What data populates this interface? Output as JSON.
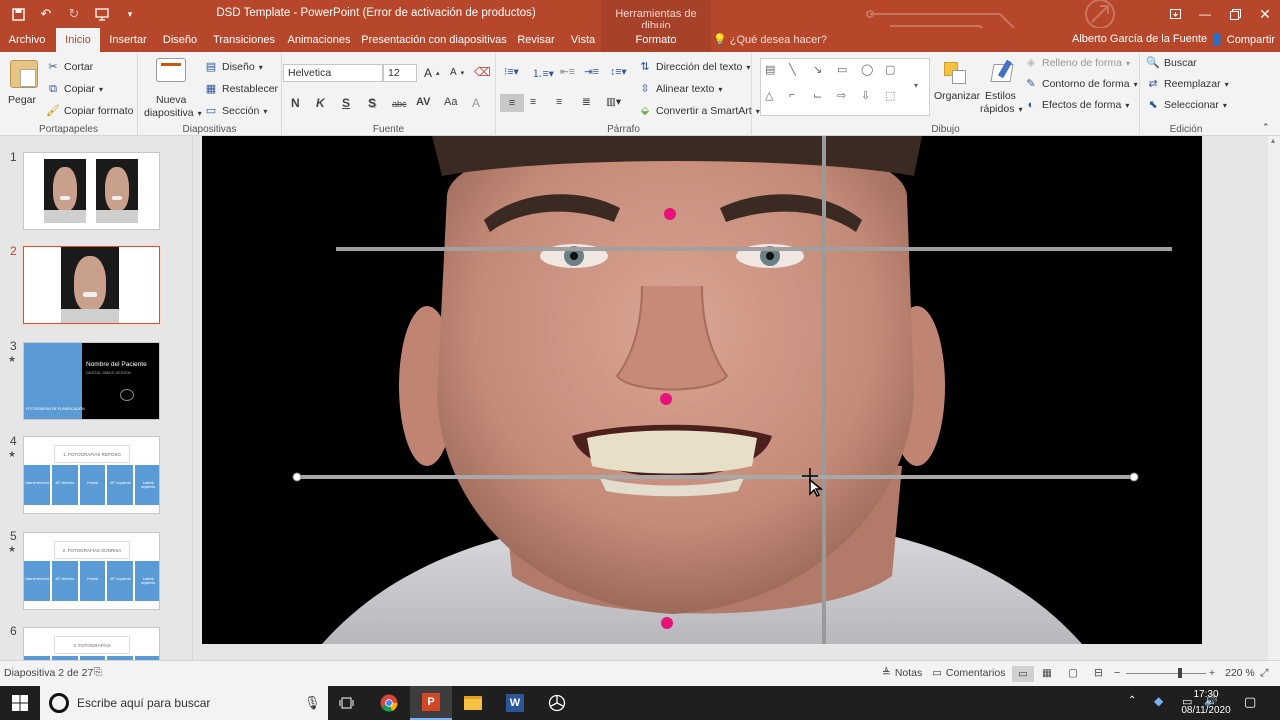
{
  "titlebar": {
    "title": "DSD Template - PowerPoint (Error de activación de productos)",
    "context_tab_group": "Herramientas de dibujo",
    "qat_icons": [
      "save-icon",
      "undo-icon",
      "redo-icon",
      "present-icon",
      "customize-icon"
    ]
  },
  "tabs": {
    "archivo": "Archivo",
    "inicio": "Inicio",
    "insertar": "Insertar",
    "diseno": "Diseño",
    "transiciones": "Transiciones",
    "animaciones": "Animaciones",
    "presentacion": "Presentación con diapositivas",
    "revisar": "Revisar",
    "vista": "Vista",
    "formato": "Formato",
    "tellme": "¿Qué desea hacer?",
    "user": "Alberto García de la Fuente",
    "share": "Compartir"
  },
  "ribbon": {
    "clipboard": {
      "label": "Portapapeles",
      "paste": "Pegar",
      "cut": "Cortar",
      "copy": "Copiar",
      "format_painter": "Copiar formato"
    },
    "slides": {
      "label": "Diapositivas",
      "new_slide_1": "Nueva",
      "new_slide_2": "diapositiva",
      "layout": "Diseño",
      "reset": "Restablecer",
      "section": "Sección"
    },
    "font": {
      "label": "Fuente",
      "family": "Helvetica",
      "size": "12",
      "bold": "N",
      "italic": "K",
      "underline": "S",
      "shadow": "S",
      "strike": "abc",
      "spacing": "AV",
      "case": "Aa"
    },
    "paragraph": {
      "label": "Párrafo",
      "text_direction": "Dirección del texto",
      "align_text": "Alinear texto",
      "smartart": "Convertir a SmartArt"
    },
    "drawing": {
      "label": "Dibujo",
      "arrange": "Organizar",
      "quick_styles_1": "Estilos",
      "quick_styles_2": "rápidos",
      "shape_fill": "Relleno de forma",
      "shape_outline": "Contorno de forma",
      "shape_effects": "Efectos de forma"
    },
    "editing": {
      "label": "Edición",
      "find": "Buscar",
      "replace": "Reemplazar",
      "select": "Seleccionar"
    }
  },
  "thumbnails": {
    "n1": "1",
    "n2": "2",
    "n3": "3",
    "n4": "4",
    "n5": "5",
    "n6": "6",
    "slide3_title": "Nombre del Paciente",
    "slide3_sub": "DIGITAL SMILE DESIGN",
    "slide3_small": "FOTOGRAFÍAS DE PLANIFICACIÓN",
    "slide4_head": "1. FOTOGRAFÍAS REPOSO",
    "slide5_head": "2. FOTOGRAFÍAS SONRISA",
    "slide6_head": "3. FOTOGRAFÍAS",
    "cells": [
      "Lateral derecha",
      "45° derecha",
      "Frontal",
      "45° izquierda",
      "Lateral izquierda"
    ]
  },
  "status": {
    "slide_info": "Diapositiva 2 de 27",
    "notes": "Notas",
    "comments": "Comentarios",
    "zoom": "220 %"
  },
  "taskbar": {
    "search_placeholder": "Escribe aquí para buscar",
    "time": "17:30",
    "date": "08/11/2020"
  },
  "colors": {
    "accent": "#b7472a",
    "slide_bg": "#000000",
    "guide_line": "#9a9a9a",
    "marker": "#e6147a"
  }
}
